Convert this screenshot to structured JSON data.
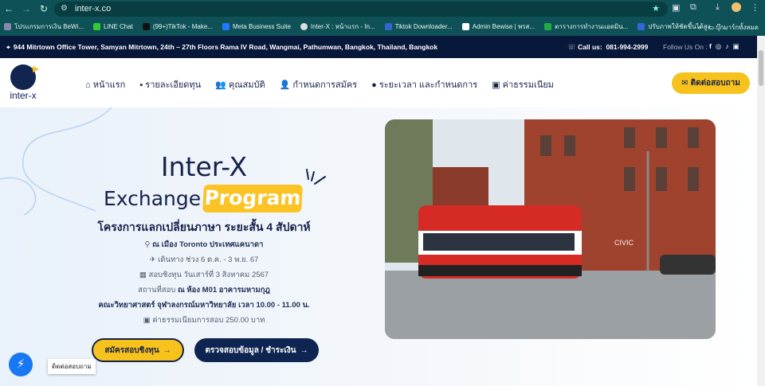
{
  "browser": {
    "url": "inter-x.co",
    "bookmarks": [
      "โปรแกรมการเงิน BeWi...",
      "LINE Chat",
      "(99+)TikTok - Make...",
      "Meta Business Suite",
      "Inter-X : หน้าแรก - In...",
      "Tiktok Downloader...",
      "Admin Bewise | พรส...",
      "ตารางการทำงานแอดมิน...",
      "ปรับภาพให้ชัดขึ้นได้สูง..."
    ],
    "more": "»",
    "all_bookmarks": "บุ๊กมาร์กทั้งหมด"
  },
  "topbar": {
    "address": "944 Mitrtown Office Tower, Samyan Mitrtown, 24th – 27th Floors Rama IV Road, Wangmai, Pathumwan, Bangkok, Thailand, Bangkok",
    "call_label": "Call us:",
    "phone": "081-994-2999",
    "follow": "Follow Us On :"
  },
  "nav": {
    "logo": "inter-x",
    "items": [
      "หน้าแรก",
      "รายละเอียดทุน",
      "คุณสมบัติ",
      "กำหนดการสมัคร",
      "ระยะเวลา และกำหนดการ",
      "ค่าธรรมเนียม"
    ],
    "cta": "ติดต่อสอบถาม"
  },
  "hero": {
    "title": "Inter-X",
    "exchange": "Exchange",
    "program": "Program",
    "subtitle": "โครงการแลกเปลี่ยนภาษา ระยะสั้น 4 สัปดาห์",
    "location": "ณ เมือง Toronto ประเทศแคนาดา",
    "travel": "เดินทาง ช่วง 6 ต.ค. - 3 พ.ย. 67",
    "exam_date": "สอบชิงทุน วันเสาร์ที่ 3 สิงหาคม 2567",
    "venue_label": "สถานที่สอบ",
    "venue": "ณ ห้อง M01 อาคารมหามกุฎ",
    "faculty": "คณะวิทยาศาสตร์ จุฬาลงกรณ์มหาวิทยาลัย เวลา 10.00 - 11.00 น.",
    "fee": "ค่าธรรมเนียมการสอบ 250.00 บาท",
    "btn_apply": "สมัครสอบชิงทุน",
    "btn_check": "ตรวจสอบข้อมูล / ชำระเงิน",
    "photo_sign": "CIVIC"
  },
  "chat": {
    "tooltip": "ติดต่อสอบถาม"
  }
}
